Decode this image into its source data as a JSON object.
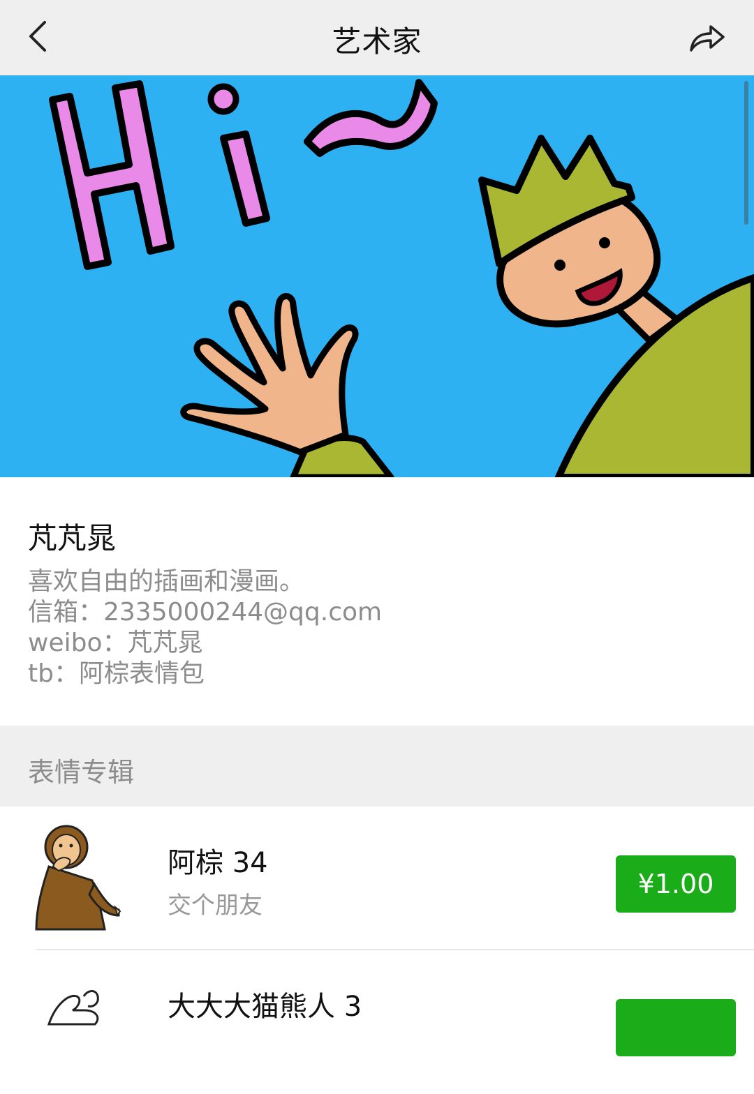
{
  "header": {
    "title": "艺术家",
    "back_icon": "chevron-left-icon",
    "share_icon": "share-arrow-icon"
  },
  "banner": {
    "text": "Hi~",
    "bg_color": "#2db1f3"
  },
  "artist": {
    "name": "芃芃晁",
    "bio_lines": [
      "喜欢自由的插画和漫画。",
      "信箱：2335000244@qq.com",
      "weibo：芃芃晁",
      "tb：阿棕表情包"
    ]
  },
  "section": {
    "title": "表情专辑"
  },
  "albums": [
    {
      "name": "阿棕 34",
      "subtitle": "交个朋友",
      "price": "¥1.00"
    },
    {
      "name": "大大大猫熊人 3",
      "subtitle": "",
      "price": ""
    }
  ],
  "colors": {
    "accent_green": "#1aad19",
    "header_bg": "#efefef"
  }
}
